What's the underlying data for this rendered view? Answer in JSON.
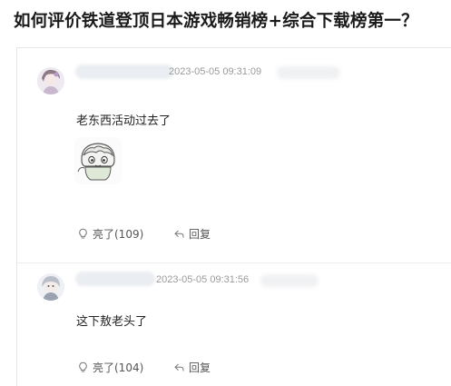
{
  "title": "如何评价铁道登顶日本游戏畅销榜+综合下载榜第一？",
  "comments": [
    {
      "timestamp": "2023-05-05 09:31:09",
      "text": "老东西活动过去了",
      "has_sticker": true,
      "like_label": "亮了(109)",
      "reply_label": "回复"
    },
    {
      "timestamp": "2023-05-05 09:31:56",
      "text": "这下敖老头了",
      "has_sticker": false,
      "like_label": "亮了(104)",
      "reply_label": "回复"
    }
  ],
  "colors": {
    "text": "#222222",
    "muted": "#9a9a9a",
    "action": "#555555",
    "divider": "#ececec"
  },
  "icons": [
    "lightbulb-icon",
    "reply-arrow-icon"
  ]
}
